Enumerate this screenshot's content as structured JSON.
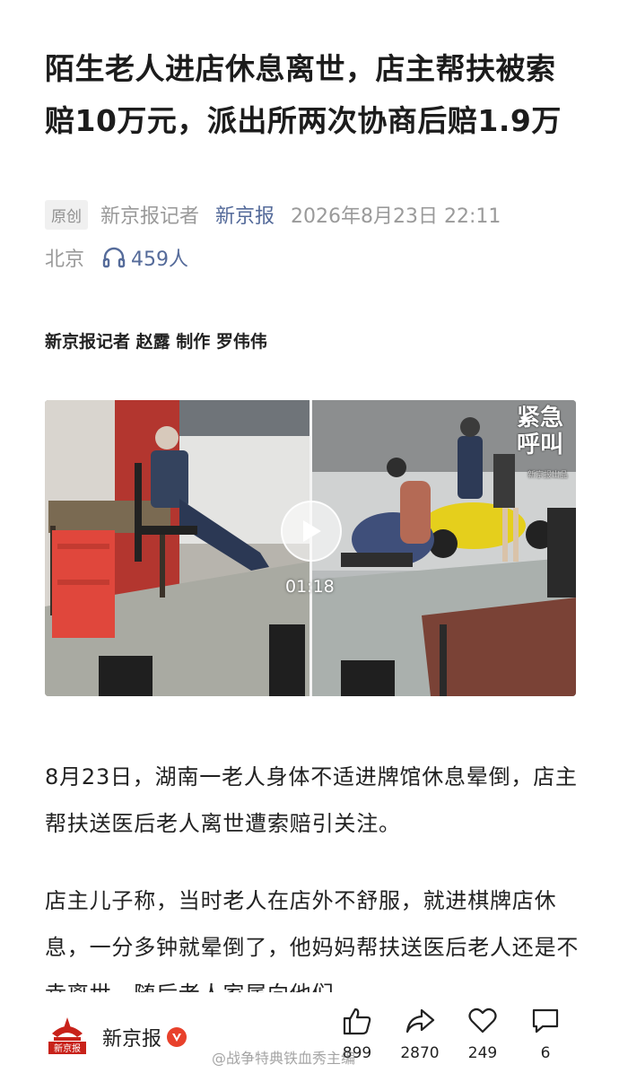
{
  "article": {
    "title": "陌生老人进店休息离世，店主帮扶被索赔10万元，派出所两次协商后赔1.9万",
    "badge": "原创",
    "author": "新京报记者",
    "source": "新京报",
    "datetime": "2026年8月23日 22:11",
    "location": "北京",
    "listeners": "459人",
    "credits": "新京报记者 赵露 制作 罗伟伟",
    "paragraphs": [
      "8月23日，湖南一老人身体不适进牌馆休息晕倒，店主帮扶送医后老人离世遭索赔引关注。",
      "店主儿子称，当时老人在店外不舒服，就进棋牌店休息，一分多钟就晕倒了，他妈妈帮扶送医后老人还是不幸离世，随后老人家属向他们"
    ]
  },
  "video": {
    "duration": "01:18",
    "overlay_logo": "紧急呼叫",
    "overlay_logo_sub": "新京报出品"
  },
  "bottom_bar": {
    "publisher": "新京报",
    "publisher_logo_text": "新京报",
    "like_count": "899",
    "share_count": "2870",
    "favorite_count": "249",
    "comment_count": "6",
    "watermark": "@战争特典铁血秀主编"
  },
  "colors": {
    "link": "#556b9a",
    "brand_red": "#c8221a",
    "verified": "#e8412b"
  }
}
